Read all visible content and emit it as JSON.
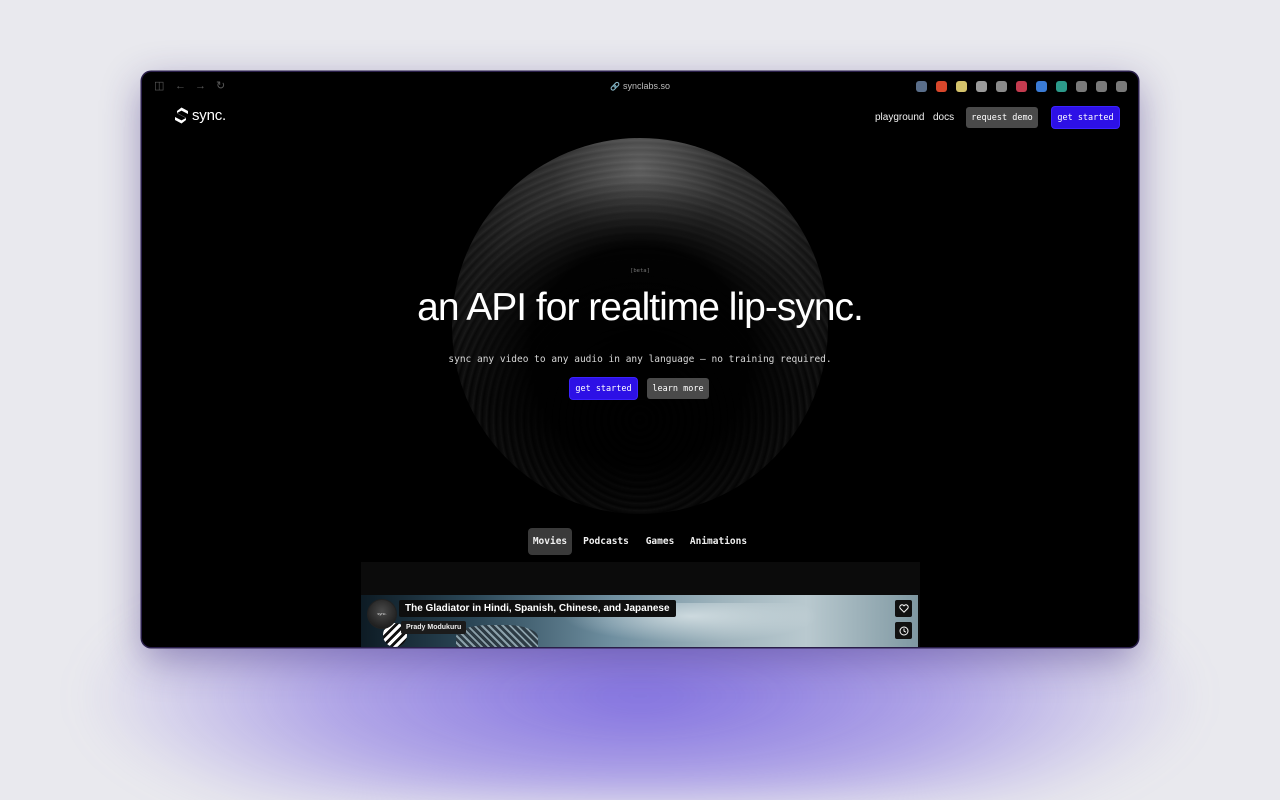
{
  "browser": {
    "url": "synclabs.so",
    "controls": [
      "sidebar-toggle-icon",
      "back-arrow-icon",
      "forward-arrow-icon",
      "reload-icon"
    ],
    "extension_colors": [
      "#5a6e8a",
      "#d9472b",
      "#d4c26a",
      "#9a9a9a",
      "#8a8a8a",
      "#c43b4f",
      "#3a7bd5",
      "#2c9a8a",
      "#7a7a7a",
      "#7a7a7a",
      "#7a7a7a"
    ]
  },
  "nav": {
    "brand": "sync.",
    "links": [
      "playground",
      "docs"
    ],
    "request_demo": "request demo",
    "get_started": "get started"
  },
  "hero": {
    "badge": "[beta]",
    "headline": "an API for realtime lip-sync.",
    "subheadline": "sync any video to any audio in any language — no training required.",
    "primary_cta": "get started",
    "secondary_cta": "learn more"
  },
  "tabs": {
    "items": [
      "Movies",
      "Podcasts",
      "Games",
      "Animations"
    ],
    "active": "Movies"
  },
  "video_card": {
    "avatar_text": "sync.",
    "title": "The Gladiator in Hindi, Spanish, Chinese, and Japanese",
    "author": "Prady Modukuru"
  },
  "colors": {
    "accent_blue": "#2d10e6",
    "button_gray": "#4a4a4a",
    "background": "#000000",
    "page_glow": "#6e5adc"
  }
}
